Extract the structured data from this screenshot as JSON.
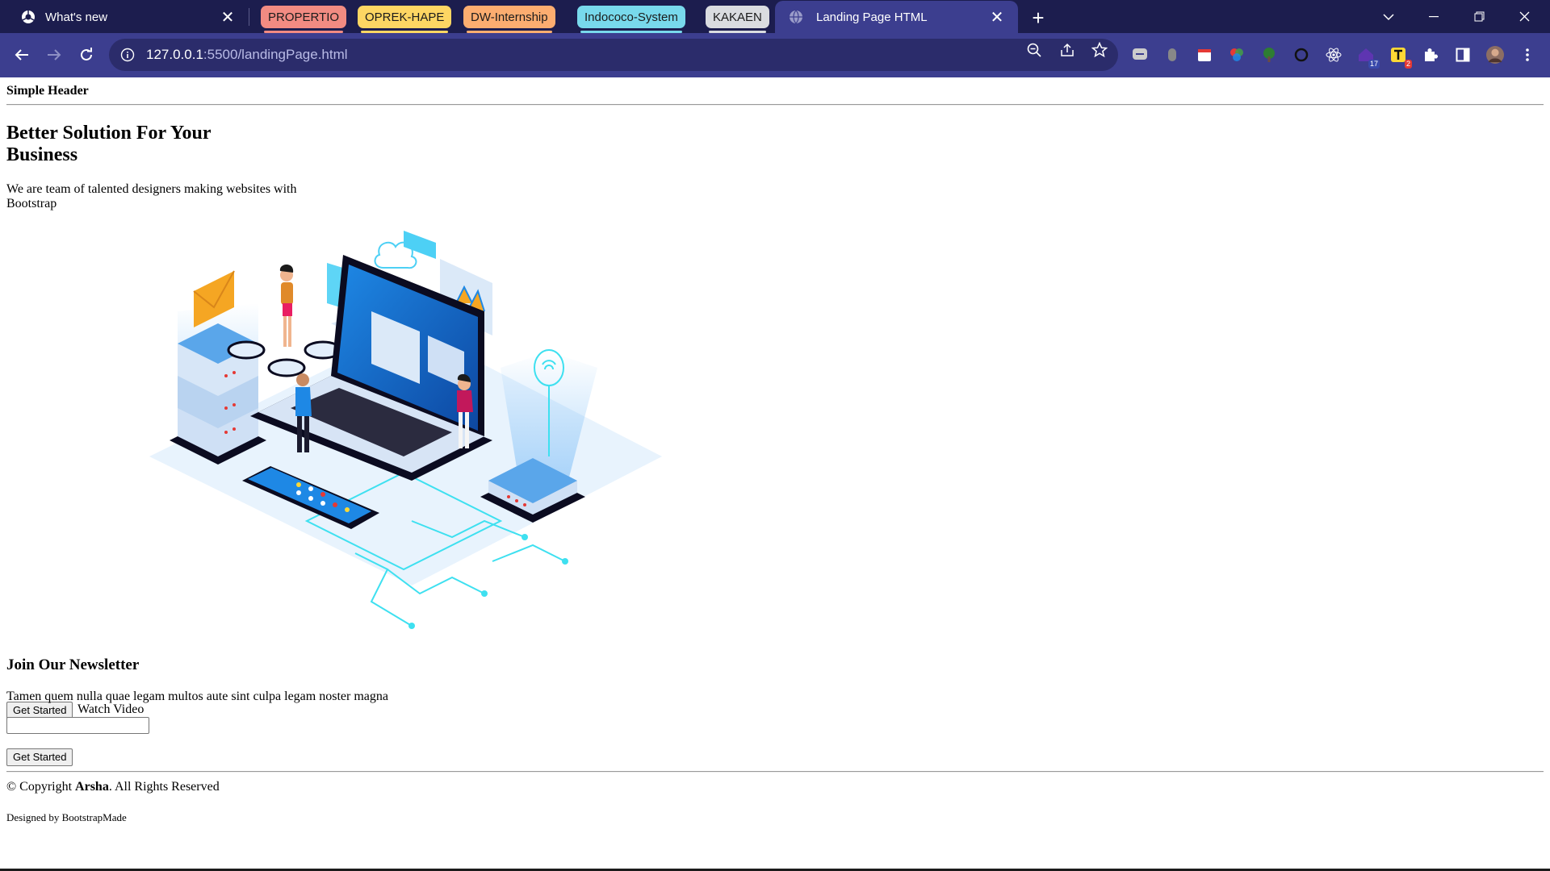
{
  "browser": {
    "tabs": {
      "first": {
        "title": "What's new"
      },
      "groups": [
        {
          "label": "PROPERTIO",
          "color": "#f28b82"
        },
        {
          "label": "OPREK-HAPE",
          "color": "#fdd663"
        },
        {
          "label": "DW-Internship",
          "color": "#fcad70"
        },
        {
          "label": "Indococo-System",
          "color": "#78d9ec"
        },
        {
          "label": "KAKAEN",
          "color": "#dadce0"
        }
      ],
      "active": {
        "title": "Landing Page HTML"
      }
    },
    "address": {
      "host": "127.0.0.1",
      "path": ":5500/landingPage.html"
    },
    "extensions": {
      "badge_a": "17",
      "badge_b": "2"
    },
    "colors": {
      "tabbar": "#1c1d4e",
      "toolbar": "#3c3e8f"
    }
  },
  "page": {
    "header": "Simple Header",
    "hero": {
      "title": "Better Solution For Your Business",
      "subtitle": "We are team of talented designers making websites with Bootstrap",
      "get_started": "Get Started",
      "watch_video": "Watch Video"
    },
    "newsletter": {
      "title": "Join Our Newsletter",
      "text": "Tamen quem nulla quae legam multos aute sint culpa legam noster magna",
      "email_value": "",
      "submit": "Get Started"
    },
    "footer": {
      "copyright_prefix": "© Copyright ",
      "brand": "Arsha",
      "copyright_suffix": ". All Rights Reserved",
      "designed_by": "Designed by BootstrapMade"
    }
  }
}
